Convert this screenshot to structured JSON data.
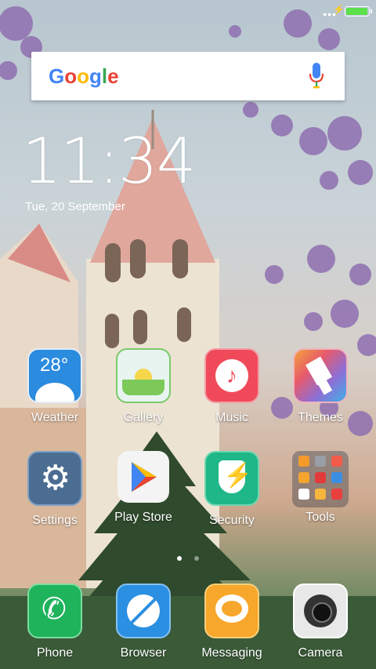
{
  "status_bar": {
    "signal_dots": "•••",
    "battery_level": 0.95
  },
  "search": {
    "brand": "Google",
    "mic_icon": "mic-icon"
  },
  "clock": {
    "time": "11:34",
    "date": "Tue, 20 September"
  },
  "apps": [
    {
      "label": "Weather",
      "temp": "28°",
      "icon": "weather-icon"
    },
    {
      "label": "Gallery",
      "icon": "gallery-icon"
    },
    {
      "label": "Music",
      "icon": "music-icon"
    },
    {
      "label": "Themes",
      "icon": "themes-icon"
    },
    {
      "label": "Settings",
      "icon": "gear-icon"
    },
    {
      "label": "Play Store",
      "icon": "play-store-icon"
    },
    {
      "label": "Security",
      "icon": "shield-icon"
    },
    {
      "label": "Tools",
      "icon": "tools-folder-icon"
    }
  ],
  "dock": [
    {
      "label": "Phone",
      "icon": "phone-icon"
    },
    {
      "label": "Browser",
      "icon": "browser-icon"
    },
    {
      "label": "Messaging",
      "icon": "message-icon"
    },
    {
      "label": "Camera",
      "icon": "camera-icon"
    }
  ],
  "pager": {
    "current_page": 1,
    "total_pages": 2
  }
}
